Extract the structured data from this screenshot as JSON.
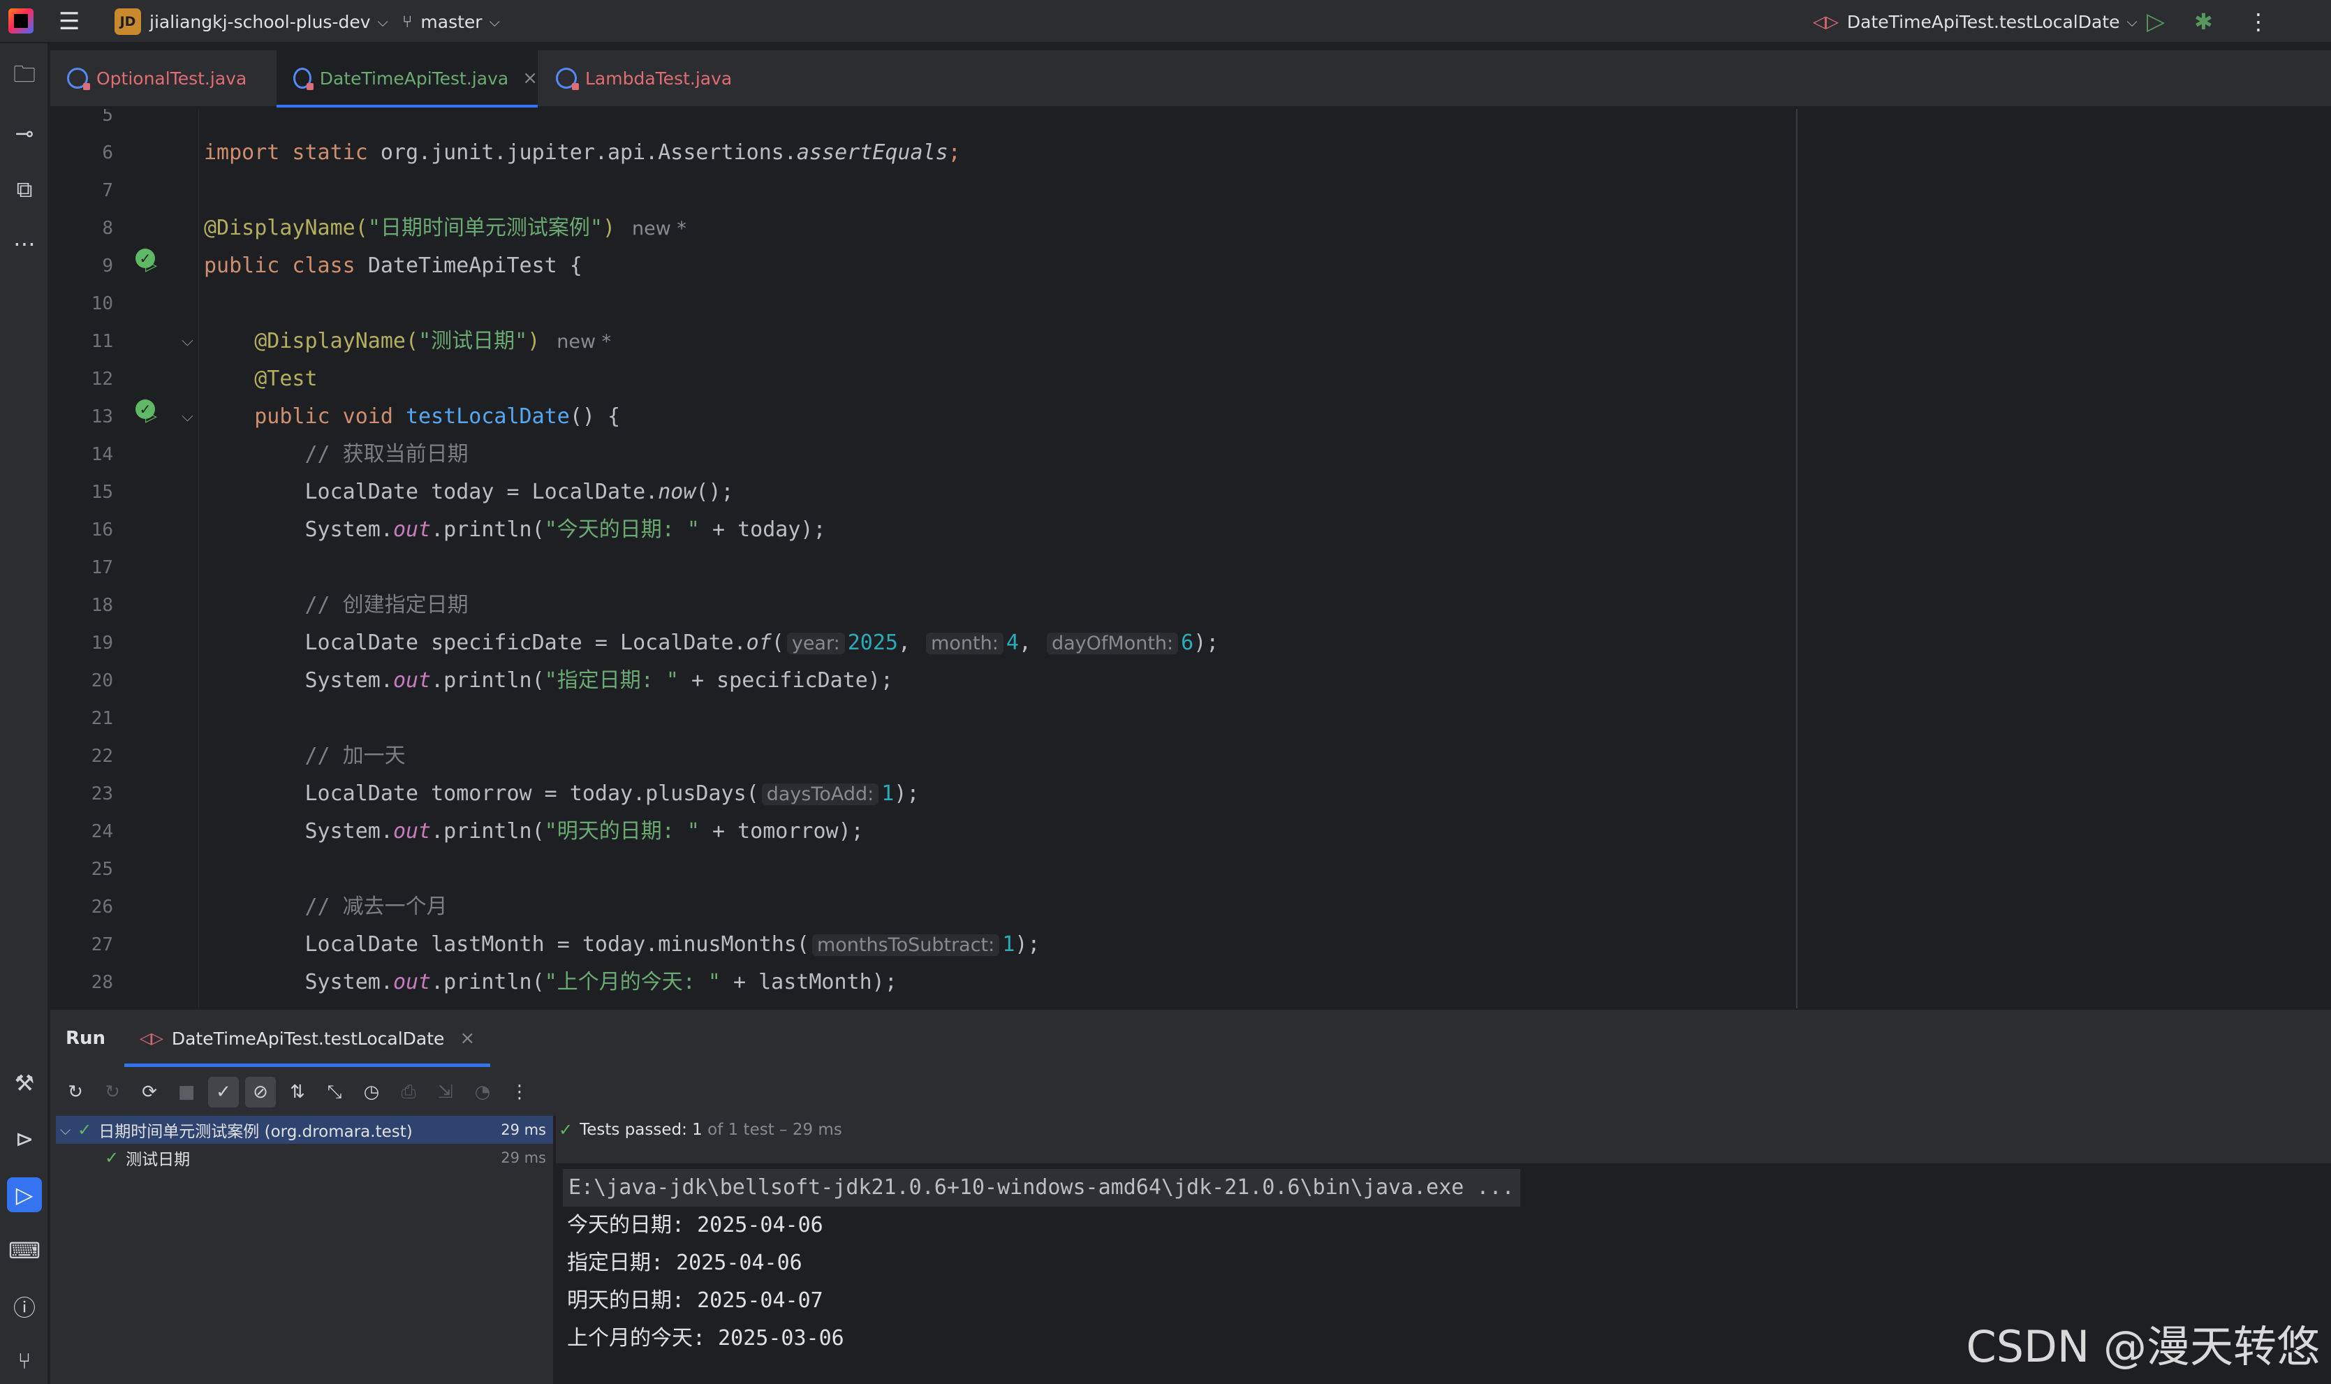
{
  "titlebar": {
    "project_badge": "JD",
    "project_name": "jialiangkj-school-plus-dev",
    "branch": "master",
    "run_config": "DateTimeApiTest.testLocalDate"
  },
  "tabs": [
    {
      "label": "OptionalTest.java",
      "color": "#e06c75"
    },
    {
      "label": "DateTimeApiTest.java",
      "color": "#6aab73"
    },
    {
      "label": "LambdaTest.java",
      "color": "#e06c75"
    }
  ],
  "editor": {
    "line_numbers": [
      "5",
      "6",
      "7",
      "8",
      "9",
      "10",
      "11",
      "12",
      "13",
      "14",
      "15",
      "16",
      "17",
      "18",
      "19",
      "20",
      "21",
      "22",
      "23",
      "24",
      "25",
      "26",
      "27",
      "28"
    ],
    "l6_kw": "import static",
    "l6_pkg": "org.junit.jupiter.api.Assertions.",
    "l6_method": "assertEquals",
    "l6_end": ";",
    "l8_ann": "@DisplayName(",
    "l8_str": "\"日期时间单元测试案例\"",
    "l8_close": ")",
    "new_hint": "new *",
    "l9_kw": "public class",
    "l9_name": "DateTimeApiTest {",
    "l11_ann": "@DisplayName(",
    "l11_str": "\"测试日期\"",
    "l11_close": ")",
    "l12_ann": "@Test",
    "l13_kw": "public void",
    "l13_fn": "testLocalDate",
    "l13_end": "() {",
    "l14_cm": "// 获取当前日期",
    "l15_a": "LocalDate today = LocalDate.",
    "l15_m": "now",
    "l15_b": "();",
    "sys": "System.",
    "out": "out",
    "println": ".println(",
    "l16_str": "\"今天的日期: \"",
    "l16_rest": " + today);",
    "l18_cm": "// 创建指定日期",
    "l19_a": "LocalDate specificDate = LocalDate.",
    "l19_m": "of",
    "l19_open": "(",
    "hint_year": "year:",
    "val_year": "2025",
    "hint_month": "month:",
    "val_month": "4",
    "hint_dom": "dayOfMonth:",
    "val_dom": "6",
    "l19_end": ");",
    "comma": ",",
    "l20_str": "\"指定日期: \"",
    "l20_rest": " + specificDate);",
    "l22_cm": "// 加一天",
    "l23_a": "LocalDate tomorrow = today.plusDays(",
    "hint_days": "daysToAdd:",
    "val_days": "1",
    "l23_end": ");",
    "l24_str": "\"明天的日期: \"",
    "l24_rest": " + tomorrow);",
    "l26_cm": "// 减去一个月",
    "l27_a": "LocalDate lastMonth = today.minusMonths(",
    "hint_months": "monthsToSubtract:",
    "val_months": "1",
    "l27_end": ");",
    "l28_str": "\"上个月的今天: \"",
    "l28_rest": " + lastMonth);"
  },
  "run": {
    "title": "Run",
    "tab_label": "DateTimeApiTest.testLocalDate",
    "tree": [
      {
        "label": "日期时间单元测试案例 (org.dromara.test)",
        "time": "29 ms"
      },
      {
        "label": "测试日期",
        "time": "29 ms"
      }
    ],
    "status_prefix": "Tests passed:",
    "status_count": "1",
    "status_suffix": "of 1 test – 29 ms",
    "console": [
      "E:\\java-jdk\\bellsoft-jdk21.0.6+10-windows-amd64\\jdk-21.0.6\\bin\\java.exe ...",
      "今天的日期: 2025-04-06",
      "指定日期: 2025-04-06",
      "明天的日期: 2025-04-07",
      "上个月的今天: 2025-03-06"
    ]
  },
  "watermark": "CSDN @漫天转悠"
}
